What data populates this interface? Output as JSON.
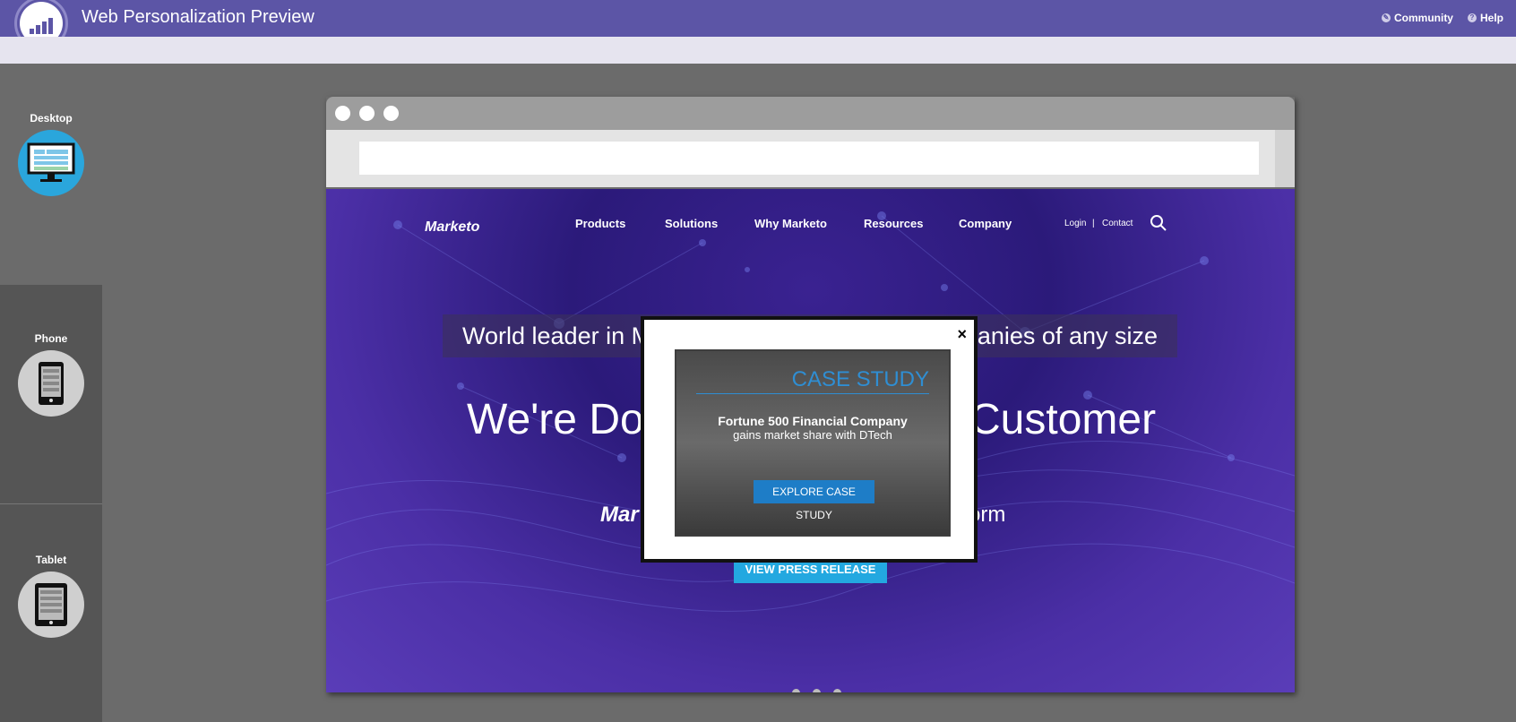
{
  "app": {
    "title": "Web Personalization Preview",
    "links": [
      {
        "label": "Community",
        "icon": "community-icon"
      },
      {
        "label": "Help",
        "icon": "help-icon"
      }
    ]
  },
  "devices": [
    {
      "label": "Desktop",
      "icon": "desktop-icon",
      "selected": true
    },
    {
      "label": "Phone",
      "icon": "phone-icon",
      "selected": false
    },
    {
      "label": "Tablet",
      "icon": "tablet-icon",
      "selected": false
    }
  ],
  "site": {
    "brand": "Marketo",
    "nav": [
      "Products",
      "Solutions",
      "Why Marketo",
      "Resources",
      "Company"
    ],
    "utility": [
      "Login",
      "|",
      "Contact"
    ],
    "banner_left": "World leader in M",
    "banner_right": "panies of any size",
    "headline_left": "We're Do",
    "headline_right": "Customer",
    "mkto_left": "Mar",
    "mkto_right": "orm",
    "cta": "VIEW PRESS RELEASE"
  },
  "modal": {
    "close": "×",
    "tag": "CASE STUDY",
    "line1": "Fortune 500 Financial Company",
    "line2": "gains market share with DTech",
    "button": "EXPLORE CASE STUDY"
  },
  "colors": {
    "brand": "#5c55a6",
    "accent": "#23a8e0",
    "case_blue": "#2f8ed3"
  }
}
